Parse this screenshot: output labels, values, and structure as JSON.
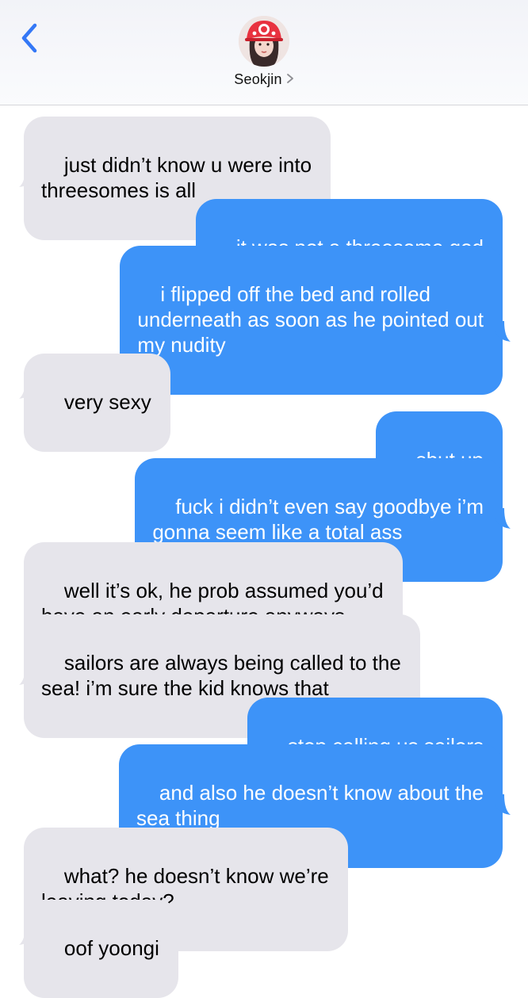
{
  "header": {
    "back_icon": "chevron-left-icon",
    "contact_name": "Seokjin",
    "contact_chevron_icon": "chevron-right-icon",
    "accent_color": "#3478f6"
  },
  "colors": {
    "incoming_bubble": "#e6e5eb",
    "outgoing_bubble": "#3d93f8",
    "incoming_text": "#000000",
    "outgoing_text": "#ffffff"
  },
  "messages": [
    {
      "direction": "incoming",
      "text": "just didn’t know u were into\nthreesomes is all"
    },
    {
      "direction": "outgoing",
      "text": "it was not a threesome god"
    },
    {
      "direction": "outgoing",
      "text": "i flipped off the bed and rolled\nunderneath as soon as he pointed out\nmy nudity"
    },
    {
      "direction": "incoming",
      "text": "very sexy"
    },
    {
      "direction": "outgoing",
      "text": "shut up"
    },
    {
      "direction": "outgoing",
      "text": "fuck i didn’t even say goodbye i’m\ngonna seem like a total ass"
    },
    {
      "direction": "incoming",
      "text": "well it’s ok, he prob assumed you’d\nhave an early departure anyways"
    },
    {
      "direction": "incoming",
      "text": "sailors are always being called to the\nsea! i’m sure the kid knows that"
    },
    {
      "direction": "outgoing",
      "text": "stop calling us sailors"
    },
    {
      "direction": "outgoing",
      "text": "and also he doesn’t know about the\nsea thing"
    },
    {
      "direction": "incoming",
      "text": "what? he doesn’t know we’re\nleaving today?"
    },
    {
      "direction": "incoming",
      "text": "oof yoongi"
    }
  ]
}
